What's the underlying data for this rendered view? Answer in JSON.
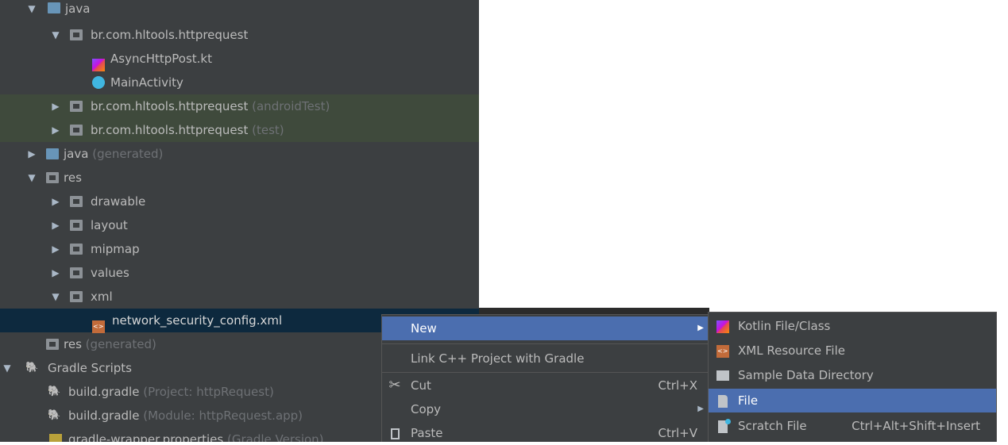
{
  "tree": [
    {
      "label": "java",
      "hint": "",
      "arrow": "▼",
      "icon": "folder-blue-icon"
    },
    {
      "label": "br.com.hltools.httprequest",
      "hint": "",
      "arrow": "▼",
      "icon": "package-folder-icon"
    },
    {
      "label": "AsyncHttpPost.kt",
      "hint": "",
      "arrow": "",
      "icon": "kotlin-file-icon"
    },
    {
      "label": "MainActivity",
      "hint": "",
      "arrow": "",
      "icon": "kotlin-class-icon"
    },
    {
      "label": "br.com.hltools.httprequest",
      "hint": "(androidTest)",
      "arrow": "▶",
      "icon": "package-folder-icon"
    },
    {
      "label": "br.com.hltools.httprequest",
      "hint": "(test)",
      "arrow": "▶",
      "icon": "package-folder-icon"
    },
    {
      "label": "java",
      "hint": "(generated)",
      "arrow": "▶",
      "icon": "generated-folder-icon"
    },
    {
      "label": "res",
      "hint": "",
      "arrow": "▼",
      "icon": "res-folder-icon"
    },
    {
      "label": "drawable",
      "hint": "",
      "arrow": "▶",
      "icon": "folder-icon"
    },
    {
      "label": "layout",
      "hint": "",
      "arrow": "▶",
      "icon": "folder-icon"
    },
    {
      "label": "mipmap",
      "hint": "",
      "arrow": "▶",
      "icon": "folder-icon"
    },
    {
      "label": "values",
      "hint": "",
      "arrow": "▶",
      "icon": "folder-icon"
    },
    {
      "label": "xml",
      "hint": "",
      "arrow": "▼",
      "icon": "folder-icon"
    },
    {
      "label": "network_security_config.xml",
      "hint": "",
      "arrow": "",
      "icon": "xml-file-icon"
    },
    {
      "label": "res",
      "hint": "(generated)",
      "arrow": "",
      "icon": "res-folder-icon"
    },
    {
      "label": "Gradle Scripts",
      "hint": "",
      "arrow": "▼",
      "icon": "gradle-icon"
    },
    {
      "label": "build.gradle",
      "hint": "(Project: httpRequest)",
      "arrow": "",
      "icon": "gradle-icon"
    },
    {
      "label": "build.gradle",
      "hint": "(Module: httpRequest.app)",
      "arrow": "",
      "icon": "gradle-icon"
    },
    {
      "label": "gradle-wrapper.properties",
      "hint": "(Gradle Version)",
      "arrow": "",
      "icon": "properties-file-icon"
    }
  ],
  "context_menu": [
    {
      "label": "New",
      "shortcut": "",
      "submenu": true,
      "icon": ""
    },
    {
      "label": "Link C++ Project with Gradle",
      "shortcut": "",
      "submenu": false,
      "icon": ""
    },
    {
      "label": "Cut",
      "shortcut": "Ctrl+X",
      "submenu": false,
      "icon": "scissors-icon"
    },
    {
      "label": "Copy",
      "shortcut": "",
      "submenu": true,
      "icon": ""
    },
    {
      "label": "Paste",
      "shortcut": "Ctrl+V",
      "submenu": false,
      "icon": "clipboard-icon"
    }
  ],
  "new_submenu": [
    {
      "label": "Kotlin File/Class",
      "shortcut": "",
      "icon": "kotlin-file-icon"
    },
    {
      "label": "XML Resource File",
      "shortcut": "",
      "icon": "xml-file-icon"
    },
    {
      "label": "Sample Data Directory",
      "shortcut": "",
      "icon": "folder-icon"
    },
    {
      "label": "File",
      "shortcut": "",
      "icon": "file-icon"
    },
    {
      "label": "Scratch File",
      "shortcut": "Ctrl+Alt+Shift+Insert",
      "icon": "scratch-file-icon"
    }
  ],
  "colors": {
    "panel_bg": "#3c3f41",
    "selection": "#4b6eaf",
    "tree_selected": "#0d293e",
    "test_tint": "#3f4a3c"
  }
}
